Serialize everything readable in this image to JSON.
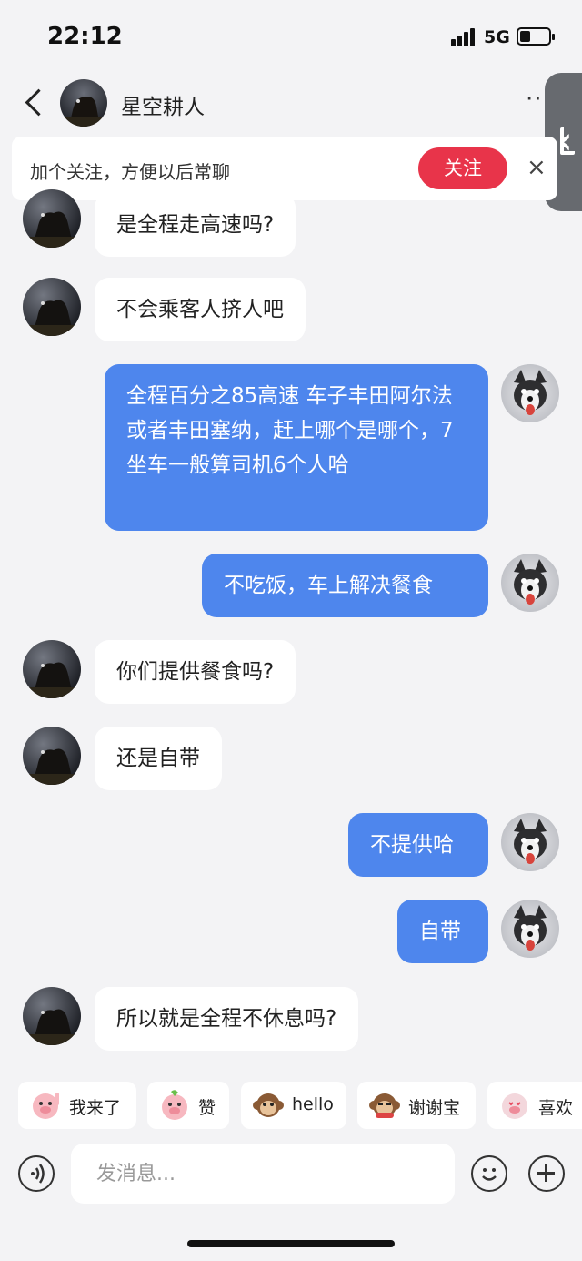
{
  "status_bar": {
    "time": "22:12",
    "network": "5G",
    "battery_level": 0.35
  },
  "header": {
    "contact_name": "星空耕人",
    "more_label": "··"
  },
  "follow_banner": {
    "text": "加个关注，方便以后常聊",
    "button": "关注",
    "close": "×"
  },
  "messages": [
    {
      "side": "in",
      "text": "是全程走高速吗?"
    },
    {
      "side": "in",
      "text": "不会乘客人挤人吧"
    },
    {
      "side": "out",
      "text": "全程百分之85高速 车子丰田阿尔法或者丰田塞纳，赶上哪个是哪个，7坐车一般算司机6个人哈"
    },
    {
      "side": "out",
      "text": "不吃饭，车上解决餐食"
    },
    {
      "side": "in",
      "text": "你们提供餐食吗?"
    },
    {
      "side": "in",
      "text": "还是自带"
    },
    {
      "side": "out",
      "text": "不提供哈"
    },
    {
      "side": "out",
      "text": "自带"
    },
    {
      "side": "in",
      "text": "所以就是全程不休息吗?"
    }
  ],
  "quick_reactions": [
    {
      "label": "我来了",
      "icon": "pig-waving-icon"
    },
    {
      "label": "赞",
      "icon": "pig-thumbs-up-icon"
    },
    {
      "label": "hello",
      "icon": "monkey-icon"
    },
    {
      "label": "谢谢宝",
      "icon": "monkey-bow-icon"
    },
    {
      "label": "喜欢",
      "icon": "pig-heart-icon"
    }
  ],
  "input": {
    "placeholder": "发消息..."
  },
  "colors": {
    "accent_blue": "#4e86ed",
    "follow_red": "#e8344a",
    "background": "#f3f3f5"
  }
}
